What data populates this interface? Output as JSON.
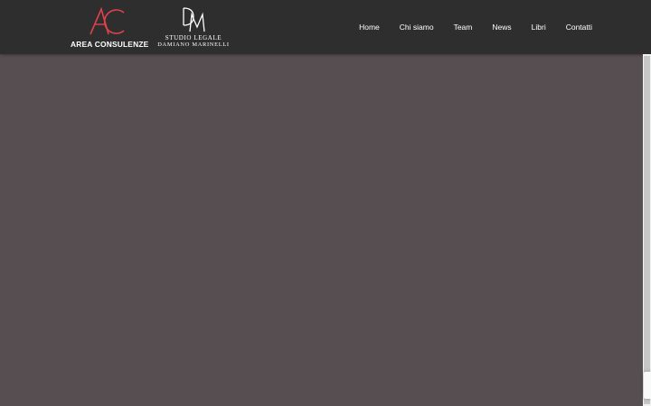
{
  "header": {
    "logo_ac": {
      "mark": "AC",
      "text": "AREA CONSULENZE",
      "mark_color": "#e0414b"
    },
    "logo_dm": {
      "mark": "DM",
      "line1": "STUDIO LEGALE",
      "line2": "DAMIANO MARINELLI"
    }
  },
  "nav": {
    "items": [
      {
        "label": "Home"
      },
      {
        "label": "Chi siamo"
      },
      {
        "label": "Team"
      },
      {
        "label": "News"
      },
      {
        "label": "Libri"
      },
      {
        "label": "Contatti"
      }
    ]
  },
  "colors": {
    "header_bg": "#2e2e2e",
    "page_bg": "#574e52",
    "accent": "#e0414b"
  },
  "icons": [
    "ac-logo-mark",
    "dm-logo-mark",
    "recaptcha-badge"
  ]
}
